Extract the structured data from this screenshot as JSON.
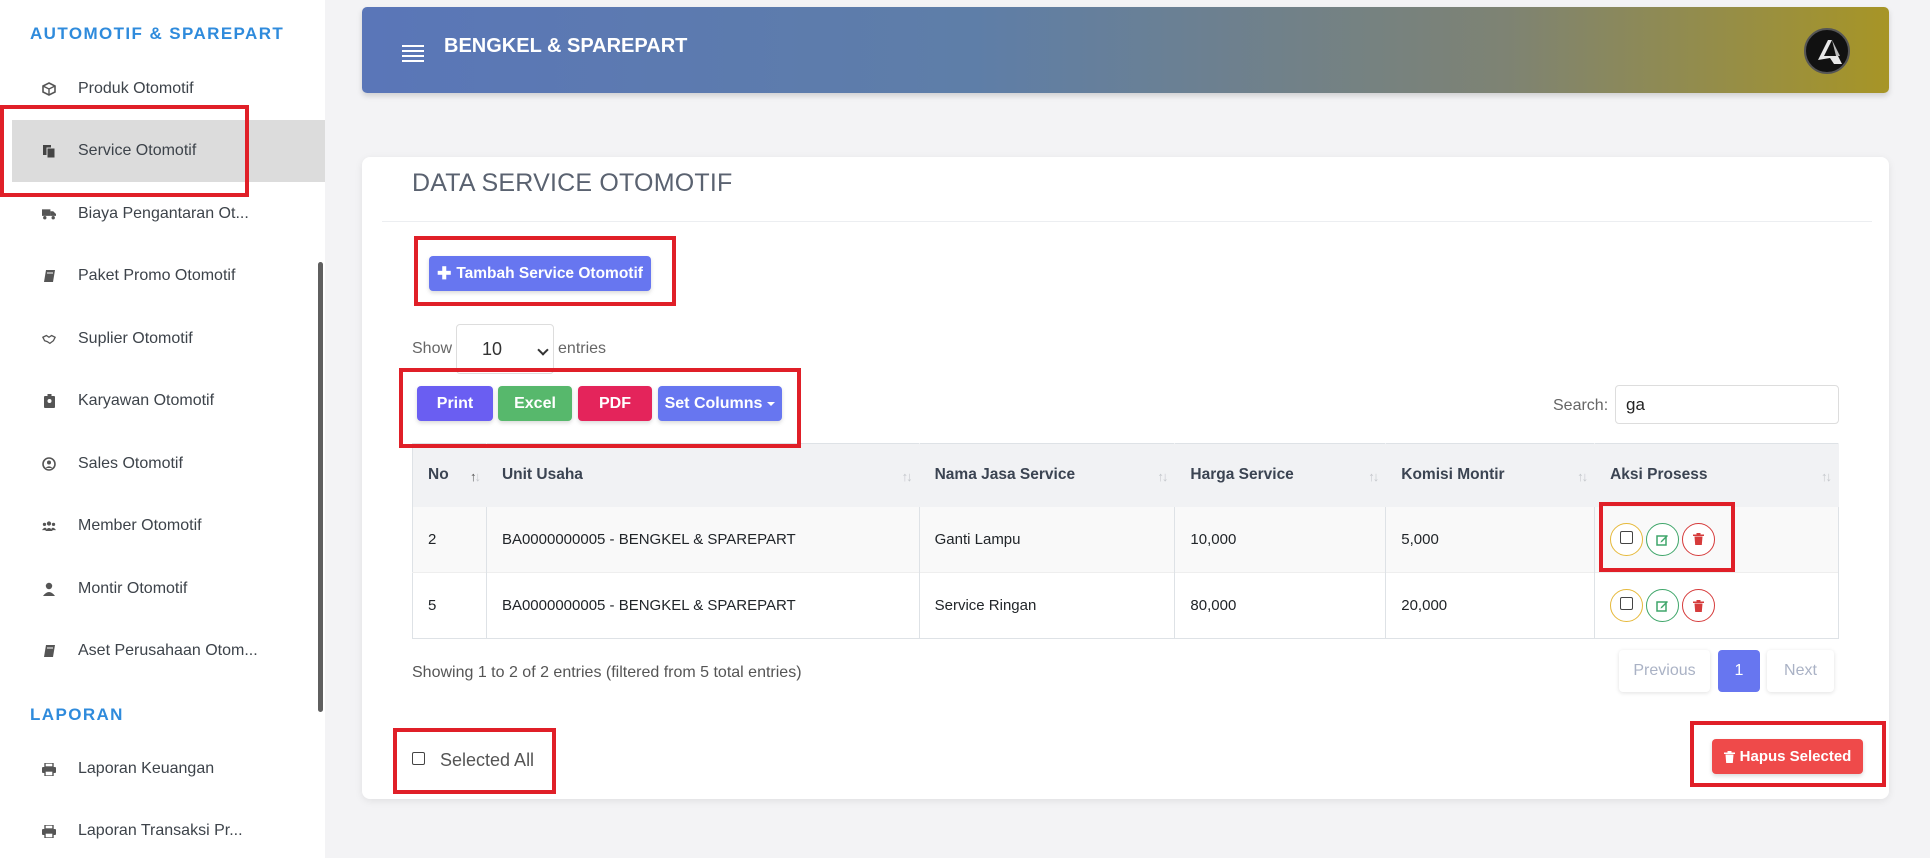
{
  "sidebar": {
    "heading_automotif": "AUTOMOTIF & SPAREPART",
    "heading_laporan": "LAPORAN",
    "items": [
      {
        "label": "Produk Otomotif",
        "icon": "box-icon"
      },
      {
        "label": "Service Otomotif",
        "icon": "copy-icon",
        "active": true
      },
      {
        "label": "Biaya Pengantaran Ot...",
        "icon": "truck-icon"
      },
      {
        "label": "Paket Promo Otomotif",
        "icon": "book-icon"
      },
      {
        "label": "Suplier Otomotif",
        "icon": "handshake-icon"
      },
      {
        "label": "Karyawan Otomotif",
        "icon": "id-badge-icon"
      },
      {
        "label": "Sales Otomotif",
        "icon": "user-circle-icon"
      },
      {
        "label": "Member Otomotif",
        "icon": "users-icon"
      },
      {
        "label": "Montir Otomotif",
        "icon": "user-icon"
      },
      {
        "label": "Aset Perusahaan Otom...",
        "icon": "book-icon"
      }
    ],
    "laporan_items": [
      {
        "label": "Laporan Keuangan",
        "icon": "print-icon"
      },
      {
        "label": "Laporan Transaksi Pr...",
        "icon": "print-icon"
      }
    ]
  },
  "header": {
    "brand": "BENGKEL & SPAREPART"
  },
  "card": {
    "title": "DATA SERVICE OTOMOTIF",
    "add_button": "Tambah Service Otomotif",
    "show_label": "Show",
    "entries_label": "entries",
    "length_value": "10",
    "export_buttons": {
      "print": "Print",
      "excel": "Excel",
      "pdf": "PDF",
      "columns": "Set Columns"
    },
    "search_label": "Search:",
    "search_value": "ga",
    "table": {
      "headers": [
        "No",
        "Unit Usaha",
        "Nama Jasa Service",
        "Harga Service",
        "Komisi Montir",
        "Aksi Prosess"
      ],
      "rows": [
        {
          "no": "2",
          "unit": "BA0000000005 - BENGKEL & SPAREPART",
          "jasa": "Ganti Lampu",
          "harga": "10,000",
          "komisi": "5,000"
        },
        {
          "no": "5",
          "unit": "BA0000000005 - BENGKEL & SPAREPART",
          "jasa": "Service Ringan",
          "harga": "80,000",
          "komisi": "20,000"
        }
      ]
    },
    "info": "Showing 1 to 2 of 2 entries (filtered from 5 total entries)",
    "pagination": {
      "previous": "Previous",
      "page": "1",
      "next": "Next"
    },
    "selected_all": "Selected All",
    "hapus_button": "Hapus Selected"
  },
  "colors": {
    "accent": "#6776f0",
    "sidebar_heading": "#2f8bdc",
    "annotation": "#e01f28"
  }
}
